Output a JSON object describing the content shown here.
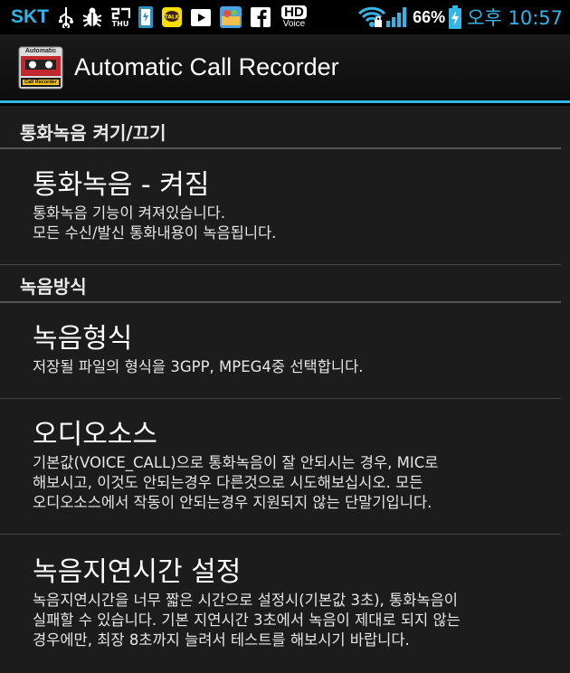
{
  "status_bar": {
    "carrier": "SKT",
    "thu_label": "THU",
    "hd_label": "HD",
    "voice_label": "Voice",
    "battery": "66%",
    "time": "오후 10:57",
    "icons": [
      "usb-icon",
      "bug-icon",
      "calendar-icon",
      "battery-saver-icon",
      "kakao-icon",
      "play-store-icon",
      "game-icon",
      "facebook-icon",
      "hd-voice-icon",
      "wifi-icon",
      "signal-icon",
      "battery-icon"
    ]
  },
  "action_bar": {
    "title": "Automatic Call Recorder",
    "icon_top": "Automatic",
    "icon_bottom": "Call Recorder"
  },
  "sections": [
    {
      "header": "통화녹음 켜기/끄기",
      "items": [
        {
          "title": "통화녹음 - 켜짐",
          "summary": [
            "통화녹음 기능이 켜져있습니다.",
            "모든 수신/발신 통화내용이 녹음됩니다."
          ]
        }
      ]
    },
    {
      "header": "녹음방식",
      "items": [
        {
          "title": "녹음형식",
          "summary": [
            "저장될 파일의 형식을 3GPP, MPEG4중 선택합니다."
          ]
        },
        {
          "title": "오디오소스",
          "summary": [
            "기본값(VOICE_CALL)으로 통화녹음이 잘 안되시는 경우, MIC로",
            "해보시고, 이것도 안되는경우 다른것으로 시도해보십시오. 모든",
            "오디오소스에서 작동이 안되는경우 지원되지 않는 단말기입니다."
          ]
        },
        {
          "title": "녹음지연시간 설정",
          "summary": [
            "녹음지연시간을 너무 짧은 시간으로 설정시(기본값 3초), 통화녹음이",
            "실패할 수 있습니다. 기본 지연시간 3초에서 녹음이 제대로 되지 않는",
            "경우에만, 최장 8초까지 늘려서 테스트를 해보시기 바랍니다."
          ]
        }
      ]
    }
  ],
  "colors": {
    "accent": "#33b5e5",
    "background": "#1c1c1c"
  }
}
